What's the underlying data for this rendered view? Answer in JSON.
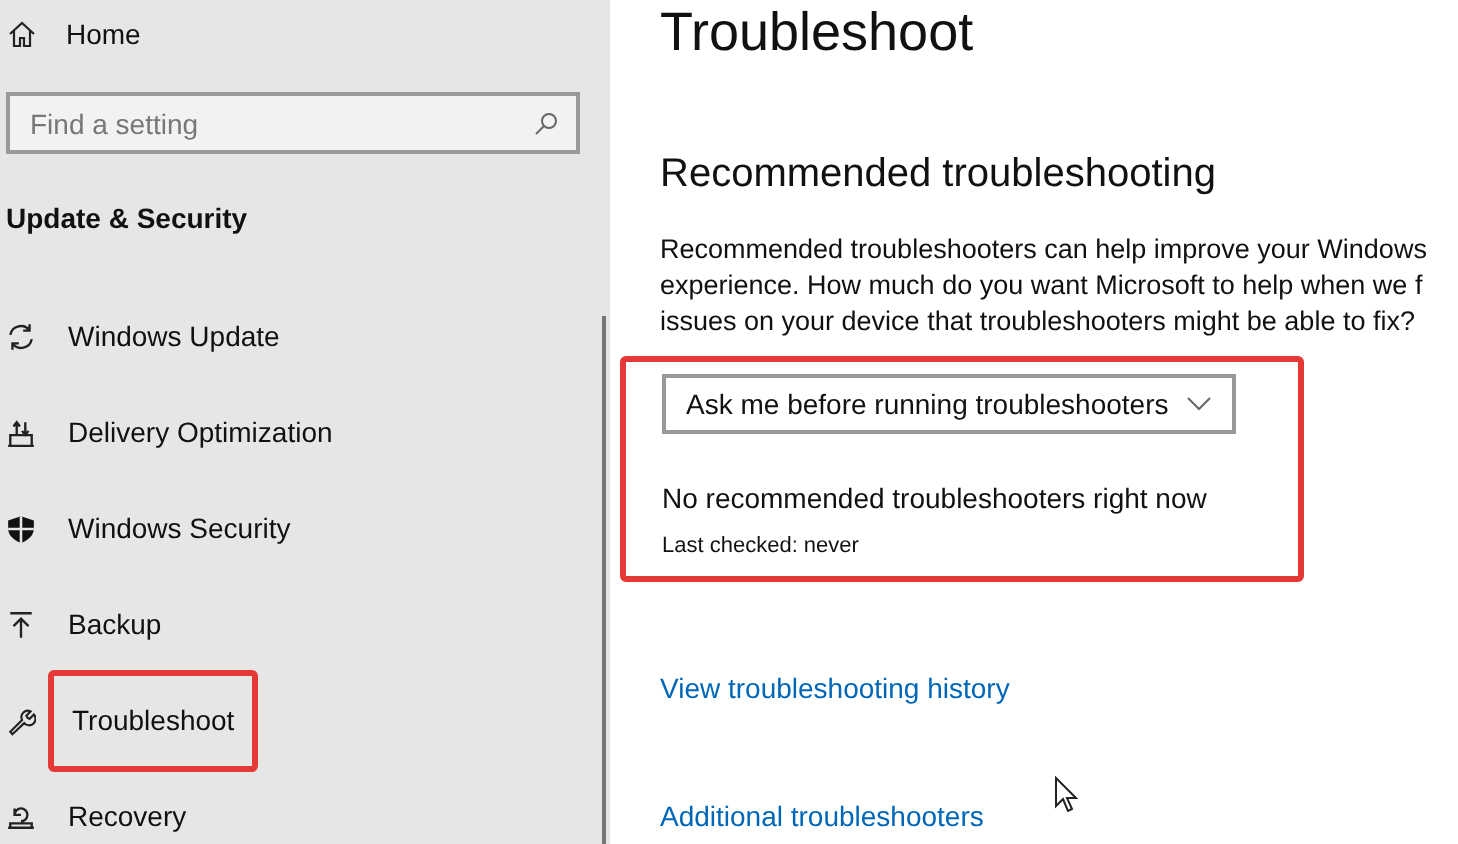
{
  "sidebar": {
    "home": "Home",
    "search": {
      "placeholder": "Find a setting"
    },
    "section_title": "Update & Security",
    "items": [
      {
        "kind": "update",
        "label": "Windows Update",
        "highlighted": false
      },
      {
        "kind": "delivery",
        "label": "Delivery Optimization",
        "highlighted": false
      },
      {
        "kind": "shield",
        "label": "Windows Security",
        "highlighted": false
      },
      {
        "kind": "backup",
        "label": "Backup",
        "highlighted": false
      },
      {
        "kind": "wrench",
        "label": "Troubleshoot",
        "highlighted": true
      },
      {
        "kind": "recovery",
        "label": "Recovery",
        "highlighted": false
      }
    ]
  },
  "main": {
    "title": "Troubleshoot",
    "section_title": "Recommended troubleshooting",
    "description_lines": [
      "Recommended troubleshooters can help improve your Windows",
      "experience. How much do you want Microsoft to help when we f",
      "issues on your device that troubleshooters might be able to fix?"
    ],
    "recommended": {
      "highlighted": true,
      "dropdown": {
        "value": "Ask me before running troubleshooters"
      },
      "status": "No recommended troubleshooters right now",
      "last_checked": "Last checked: never"
    },
    "links": [
      "View troubleshooting history",
      "Additional troubleshooters"
    ]
  }
}
